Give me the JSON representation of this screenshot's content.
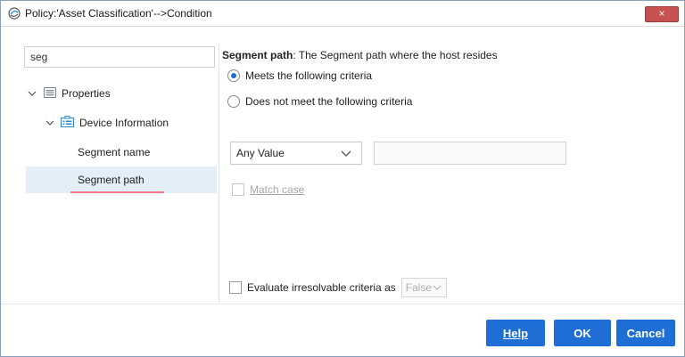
{
  "window": {
    "title": "Policy:'Asset Classification'-->Condition",
    "close_label": "×"
  },
  "left": {
    "search_value": "seg",
    "tree": {
      "properties": "Properties",
      "device_information": "Device Information",
      "segment_name": "Segment name",
      "segment_path": "Segment path"
    }
  },
  "right": {
    "desc_title": "Segment path",
    "desc_text": ": The Segment path where the host resides",
    "radio_meets": "Meets the following criteria",
    "radio_not_meets": "Does not meet the following criteria",
    "match_select": "Any Value",
    "match_case": "Match case",
    "evaluate_label": "Evaluate irresolvable criteria as",
    "evaluate_value": "False"
  },
  "buttons": {
    "help": "Help",
    "ok": "OK",
    "cancel": "Cancel"
  },
  "colors": {
    "accent": "#1f6ed6",
    "selected_row": "#e3eef6",
    "close": "#c75050",
    "underline": "#f07a8a"
  }
}
